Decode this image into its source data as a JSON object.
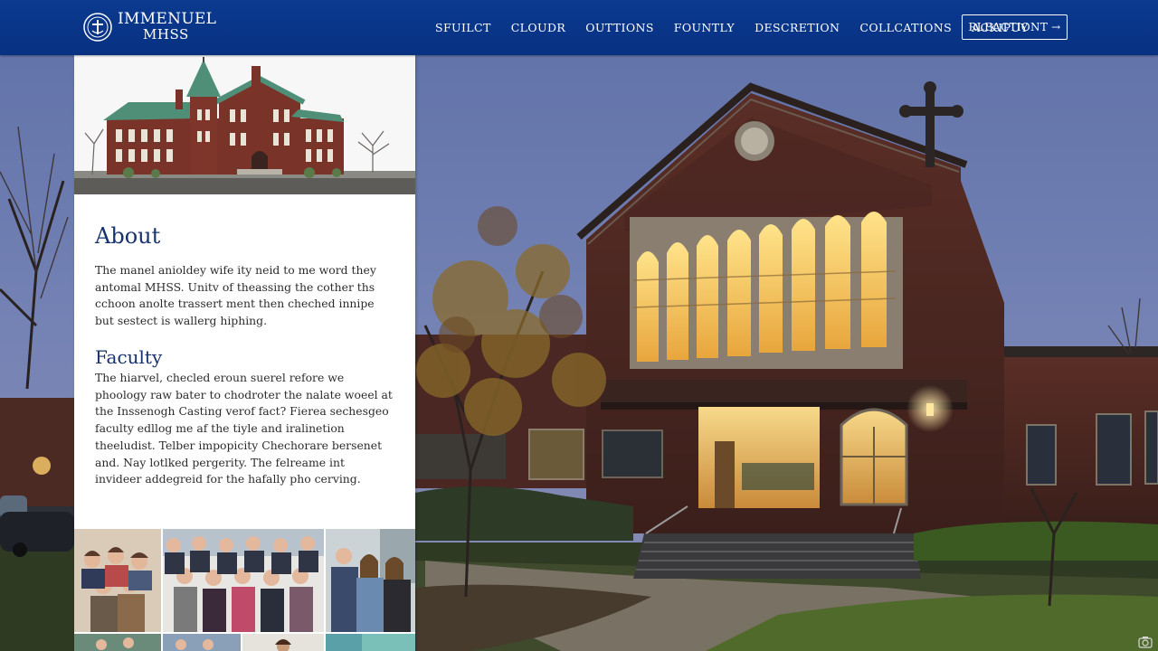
{
  "site": {
    "logo_line1": "IMMENUEL",
    "logo_line2": "MHSS"
  },
  "nav": {
    "items": [
      {
        "label": "SFUILCT"
      },
      {
        "label": "CLOUDR"
      },
      {
        "label": "OUTTIONS"
      },
      {
        "label": "FOUNTLY"
      },
      {
        "label": "DESCRETION"
      },
      {
        "label": "COLLCATIONS"
      },
      {
        "label": "ACKIPUY"
      }
    ],
    "cta_label": "RLEACTIONT",
    "cta_arrow": "→"
  },
  "about": {
    "title": "About",
    "text": "The manel anioldey wife ity neid to me word they antomal MHSS. Unitv of theassing the cother ths cchoon anolte trassert ment then cheched innipe but sestect is wallerg hiphing."
  },
  "faculty": {
    "title": "Faculty",
    "text": "The hiarvel, checled eroun suerel refore we phoology raw bater to chodroter the nalate woeel at the Inssenogh Casting verof fact? Fierea sechesgeo faculty edllog me af the tiyle and iralinetion theeludist. Telber impopicity Chechorare bersenet and. Nay lotlked pergerity. The felreame int invideer addegreid for the hafally pho cerving."
  },
  "colors": {
    "nav_bg": "#0b3a8f",
    "heading": "#17336d",
    "body_text": "#2b2b2b",
    "panel_bg": "#ffffff"
  },
  "icons": {
    "logo": "school-crest-icon",
    "cta": "arrow-right-icon",
    "corner": "camera-icon"
  }
}
